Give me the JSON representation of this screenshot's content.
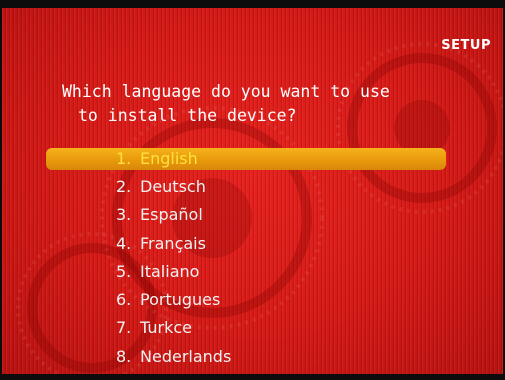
{
  "screen": {
    "setup_label": "SETUP",
    "question": {
      "line1": "Which language do you want to use",
      "line2": "to install the device?"
    }
  },
  "languages": [
    {
      "num": "1.",
      "label": "English",
      "selected": true
    },
    {
      "num": "2.",
      "label": "Deutsch",
      "selected": false
    },
    {
      "num": "3.",
      "label": "Español",
      "selected": false
    },
    {
      "num": "4.",
      "label": "Français",
      "selected": false
    },
    {
      "num": "5.",
      "label": "Italiano",
      "selected": false
    },
    {
      "num": "6.",
      "label": "Portugues",
      "selected": false
    },
    {
      "num": "7.",
      "label": "Turkce",
      "selected": false
    },
    {
      "num": "8.",
      "label": "Nederlands",
      "selected": false
    }
  ],
  "colors": {
    "background": "#d61a16",
    "highlight": "#f0a514",
    "highlight_text": "#ffe13a",
    "text": "#ffffff"
  }
}
